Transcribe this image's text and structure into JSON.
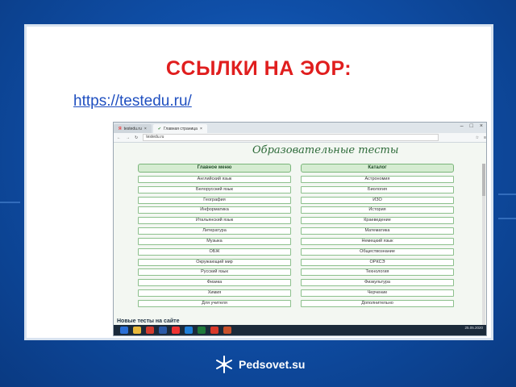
{
  "slide": {
    "title": "ССЫЛКИ НА ЭОР:",
    "link": "https://testedu.ru/"
  },
  "browser": {
    "tabs": [
      {
        "label": "testedu.ru",
        "active": false
      },
      {
        "label": "Главная страница",
        "active": true
      }
    ],
    "address": "testedu.ru",
    "site_title": "Образовательные тесты",
    "left_head": "Главное меню",
    "right_head": "Каталог",
    "left_items": [
      "Английский язык",
      "Белорусский язык",
      "География",
      "Информатика",
      "Итальянский язык",
      "Литература",
      "Музыка",
      "ОБЖ",
      "Окружающий мир",
      "Русский язык",
      "Физика",
      "Химия",
      "Для учителя"
    ],
    "right_items": [
      "Астрономия",
      "Биология",
      "ИЗО",
      "История",
      "Краеведение",
      "Математика",
      "Немецкий язык",
      "Обществознание",
      "ОРКСЭ",
      "Технология",
      "Физкультура",
      "Черчение",
      "Дополнительно"
    ],
    "new_tests": "Новые тесты на сайте",
    "clock_time": "25.05.2020"
  },
  "footer": {
    "brand": "Pedsovet.su"
  },
  "colors": {
    "title": "#e01e1e",
    "link": "#1f4fc0",
    "background": "#0f4fa8"
  }
}
